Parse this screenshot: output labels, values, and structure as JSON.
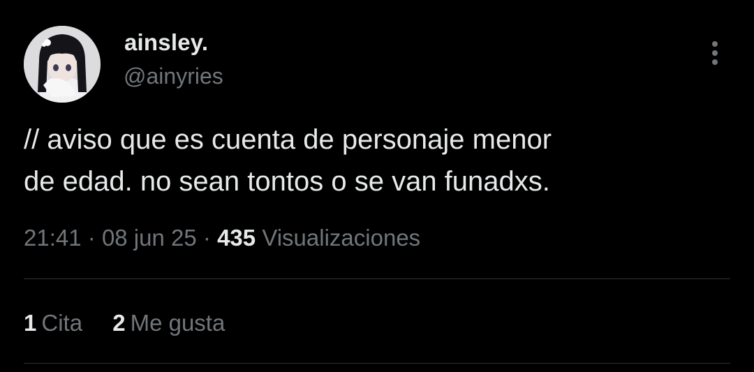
{
  "author": {
    "display_name": "ainsley.",
    "handle": "@ainyries",
    "avatar_icon": "profile-avatar"
  },
  "more_icon": "more-vertical-icon",
  "tweet": {
    "text": "// aviso que es cuenta de personaje menor\nde edad. no sean tontos o se van funadxs."
  },
  "meta": {
    "time": "21:41",
    "separator": "·",
    "date": "08 jun 25",
    "views_count": "435",
    "views_label": "Visualizaciones"
  },
  "stats": {
    "quotes_count": "1",
    "quotes_label": "Cita",
    "likes_count": "2",
    "likes_label": "Me gusta"
  },
  "colors": {
    "background": "#000000",
    "primary_text": "#e7e9ea",
    "secondary_text": "#71767b",
    "divider": "#2f3336"
  }
}
